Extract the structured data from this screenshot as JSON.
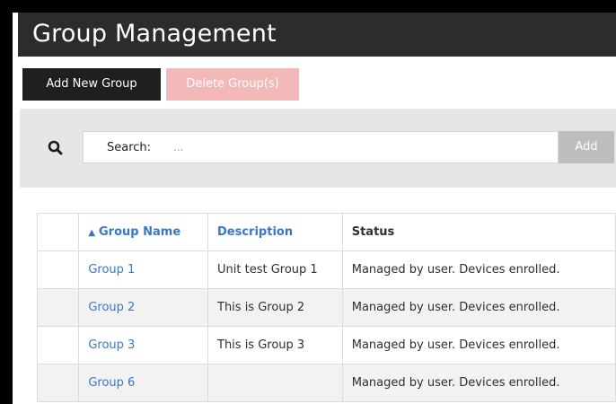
{
  "header": {
    "title": "Group Management"
  },
  "toolbar": {
    "add_group_label": "Add New Group",
    "delete_groups_label": "Delete Group(s)"
  },
  "search": {
    "label": "Search:",
    "placeholder": "...",
    "value": "",
    "add_label": "Add",
    "icon": "search-icon"
  },
  "table": {
    "columns": [
      {
        "label": "Group Name",
        "sorted": "ascending",
        "sort_indicator": "▲"
      },
      {
        "label": "Description"
      },
      {
        "label": "Status"
      }
    ],
    "rows": [
      {
        "name": "Group 1",
        "description": "Unit test Group 1",
        "status": "Managed by user. Devices enrolled."
      },
      {
        "name": "Group 2",
        "description": "This is Group 2",
        "status": "Managed by user. Devices enrolled."
      },
      {
        "name": "Group 3",
        "description": "This is Group 3",
        "status": "Managed by user. Devices enrolled."
      },
      {
        "name": "Group 6",
        "description": "",
        "status": "Managed by user. Devices enrolled."
      }
    ]
  },
  "colors": {
    "title_bar": "#2c2c2c",
    "primary_button": "#1f1f1f",
    "delete_button_disabled": "#f3b8b8",
    "link": "#3a78c3",
    "panel": "#e6e6e6"
  }
}
